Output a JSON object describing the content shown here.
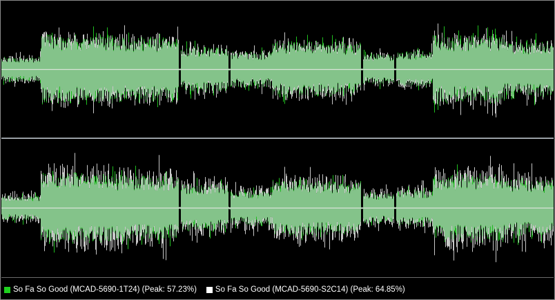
{
  "colors": {
    "background": "#000000",
    "track_a_fill": "#84c38a",
    "track_a_edge": "#1fbf1f",
    "track_b_edge": "#c8c8c8",
    "center_line": "#d9e3d9",
    "separator": "#9aa0a6"
  },
  "legend": [
    {
      "label": "So Fa So Good (MCAD-5690-1T24) (Peak: 57.23%)",
      "color": "#1fd11f"
    },
    {
      "label": "So Fa So Good (MCAD-5690-S2C14) (Peak: 64.85%)",
      "color": "#ffffff"
    }
  ],
  "waveform": {
    "peaks_percent": [
      57.23,
      64.85
    ],
    "envelope_segments": [
      {
        "start": 0.0,
        "end": 0.07,
        "amp": 0.18
      },
      {
        "start": 0.07,
        "end": 0.2,
        "amp": 0.5
      },
      {
        "start": 0.2,
        "end": 0.32,
        "amp": 0.46
      },
      {
        "start": 0.325,
        "end": 0.41,
        "amp": 0.33
      },
      {
        "start": 0.415,
        "end": 0.49,
        "amp": 0.25
      },
      {
        "start": 0.49,
        "end": 0.57,
        "amp": 0.4
      },
      {
        "start": 0.57,
        "end": 0.65,
        "amp": 0.38
      },
      {
        "start": 0.655,
        "end": 0.71,
        "amp": 0.22
      },
      {
        "start": 0.715,
        "end": 0.78,
        "amp": 0.26
      },
      {
        "start": 0.78,
        "end": 0.91,
        "amp": 0.48
      },
      {
        "start": 0.91,
        "end": 1.0,
        "amp": 0.4
      }
    ]
  }
}
